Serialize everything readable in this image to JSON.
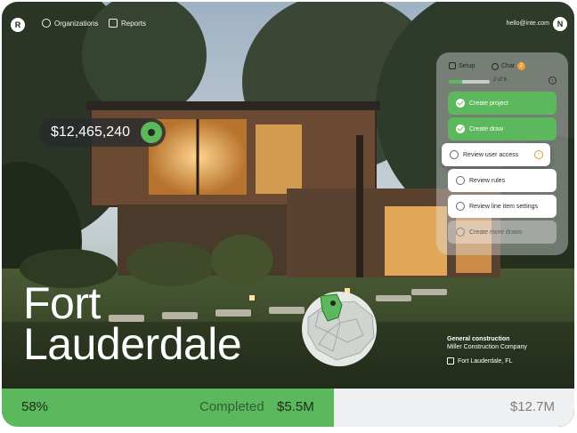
{
  "nav": {
    "logo": "R",
    "organizations": "Organizations",
    "reports": "Reports",
    "email": "hello@inte.com",
    "avatar": "N"
  },
  "property": {
    "price": "$12,465,240",
    "city": "Fort Lauderdale",
    "role": "General construction",
    "company": "Miller Construction Company",
    "location": "Fort Lauderdale, FL"
  },
  "checklist": {
    "tab_setup": "Setup",
    "tab_chat": "Chat",
    "chat_count": "2",
    "progress_text": "2 of 6",
    "progress_fraction": 0.33,
    "steps": [
      {
        "label": "Create project",
        "state": "done"
      },
      {
        "label": "Create draw",
        "state": "done"
      },
      {
        "label": "Review user access",
        "state": "active"
      },
      {
        "label": "Review rules",
        "state": "todo"
      },
      {
        "label": "Review line item settings",
        "state": "todo"
      },
      {
        "label": "Create more draws",
        "state": "faded"
      }
    ]
  },
  "progress": {
    "percent": "58%",
    "completed_label": "Completed",
    "completed_value": "$5.5M",
    "total": "$12.7M",
    "fraction": 0.58
  },
  "colors": {
    "accent": "#5cb85c",
    "panel": "#dcdee0",
    "bar_bg": "#eff0f1"
  },
  "icons": [
    "organizations-icon",
    "reports-icon",
    "setup-icon",
    "chat-icon",
    "check-icon",
    "arrow-right-icon",
    "location-icon"
  ]
}
